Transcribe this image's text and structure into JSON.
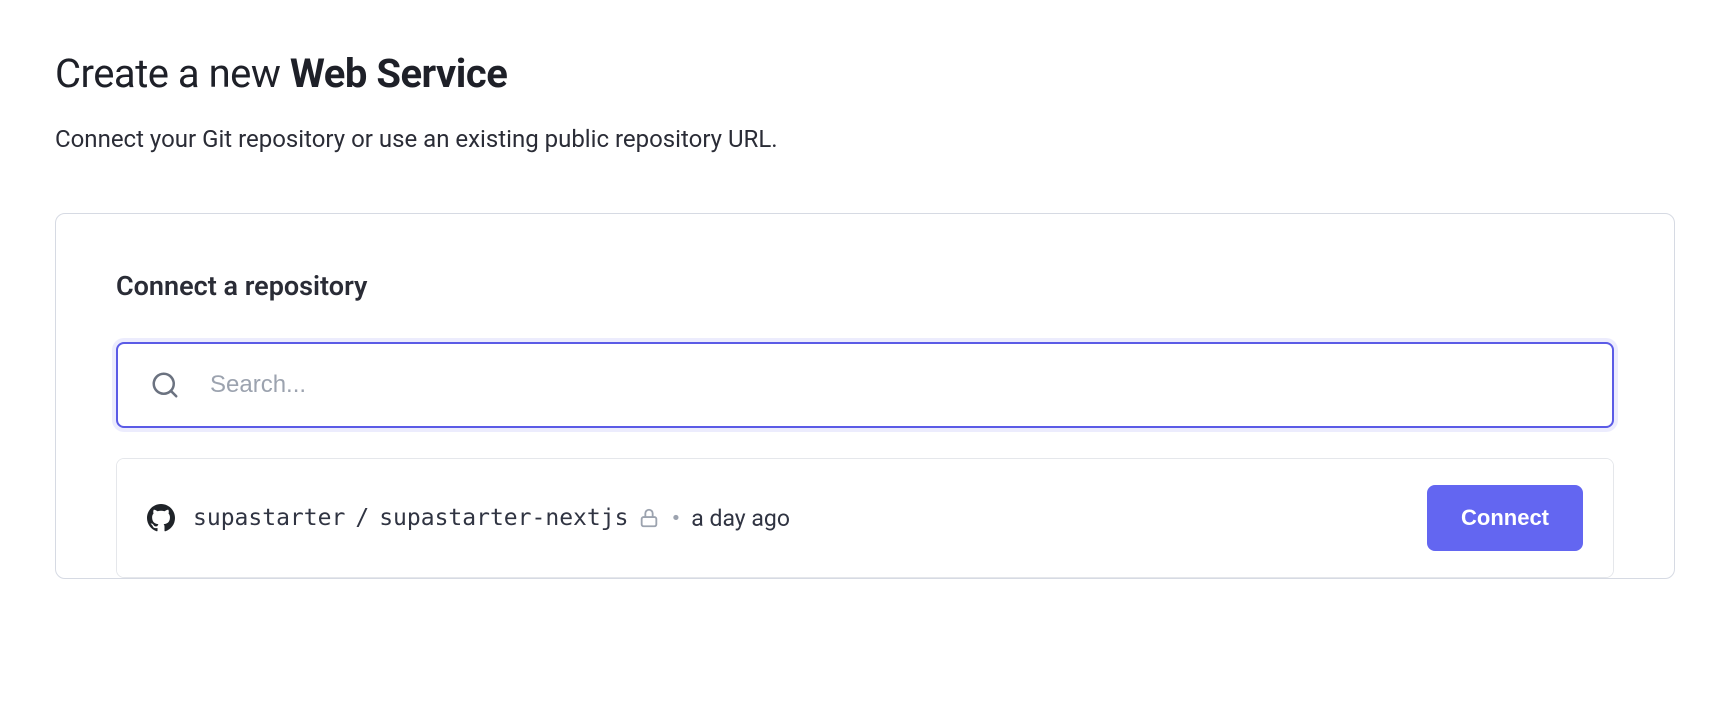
{
  "header": {
    "title_prefix": "Create a new ",
    "title_bold": "Web Service",
    "subtitle": "Connect your Git repository or use an existing public repository URL."
  },
  "panel": {
    "title": "Connect a repository",
    "search_placeholder": "Search..."
  },
  "repos": [
    {
      "owner": "supastarter",
      "name": "supastarter-nextjs",
      "private": true,
      "updated": "a day ago",
      "action_label": "Connect"
    }
  ],
  "separator": "/",
  "dot": "•"
}
